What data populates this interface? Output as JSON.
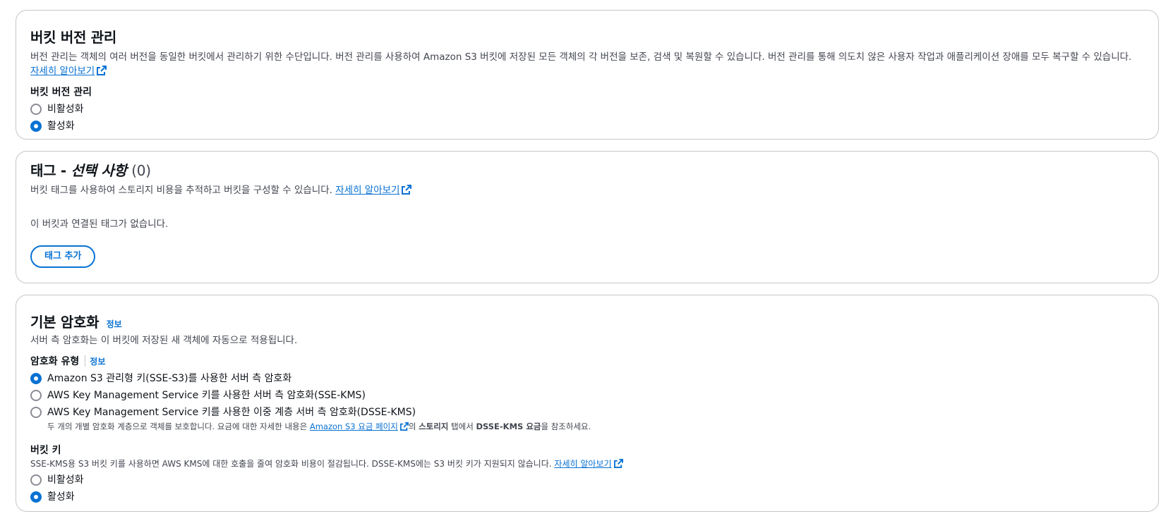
{
  "versioning": {
    "title": "버킷 버전 관리",
    "description": "버전 관리는 객체의 여러 버전을 동일한 버킷에서 관리하기 위한 수단입니다. 버전 관리를 사용하여 Amazon S3 버킷에 저장된 모든 객체의 각 버전을 보존, 검색 및 복원할 수 있습니다. 버전 관리를 통해 의도치 않은 사용자 작업과 애플리케이션 장애를 모두 복구할 수 있습니다.",
    "learn_more": "자세히 알아보기",
    "field_label": "버킷 버전 관리",
    "options": [
      "비활성화",
      "활성화"
    ],
    "selected": "활성화"
  },
  "tags": {
    "title_main": "태그 - ",
    "title_italic": "선택 사항",
    "count": "(0)",
    "description": "버킷 태그를 사용하여 스토리지 비용을 추적하고 버킷을 구성할 수 있습니다.",
    "learn_more": "자세히 알아보기",
    "empty_text": "이 버킷과 연결된 태그가 없습니다.",
    "add_button": "태그 추가"
  },
  "encryption": {
    "title": "기본 암호화",
    "info": "정보",
    "description": "서버 측 암호화는 이 버킷에 저장된 새 객체에 자동으로 적용됩니다.",
    "type_label": "암호화 유형",
    "type_info": "정보",
    "options": [
      "Amazon S3 관리형 키(SSE-S3)를 사용한 서버 측 암호화",
      "AWS Key Management Service 키를 사용한 서버 측 암호화(SSE-KMS)",
      "AWS Key Management Service 키를 사용한 이중 계층 서버 측 암호화(DSSE-KMS)"
    ],
    "selected": "Amazon S3 관리형 키(SSE-S3)를 사용한 서버 측 암호화",
    "dsse_note_1": "두 개의 개별 암호화 계층으로 객체를 보호합니다. 요금에 대한 자세한 내용은 ",
    "dsse_note_link": "Amazon S3 요금 페이지",
    "dsse_note_2": "의 ",
    "dsse_note_bold1": "스토리지",
    "dsse_note_3": " 탭에서 ",
    "dsse_note_bold2": "DSSE-KMS 요금",
    "dsse_note_4": "을 참조하세요.",
    "bucket_key_label": "버킷 키",
    "bucket_key_desc": "SSE-KMS용 S3 버킷 키를 사용하면 AWS KMS에 대한 호출을 줄여 암호화 비용이 절감됩니다. DSSE-KMS에는 S3 버킷 키가 지원되지 않습니다.",
    "bucket_key_learn_more": "자세히 알아보기",
    "bucket_key_options": [
      "비활성화",
      "활성화"
    ],
    "bucket_key_selected": "활성화"
  }
}
